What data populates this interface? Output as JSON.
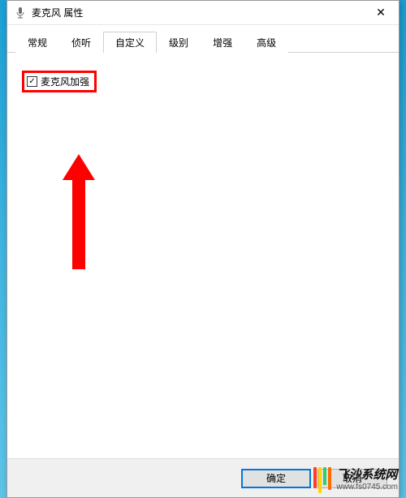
{
  "window": {
    "title": "麦克风 属性",
    "close_label": "✕"
  },
  "tabs": [
    {
      "label": "常规"
    },
    {
      "label": "侦听"
    },
    {
      "label": "自定义"
    },
    {
      "label": "级别"
    },
    {
      "label": "增强"
    },
    {
      "label": "高级"
    }
  ],
  "active_tab_index": 2,
  "custom_tab": {
    "mic_boost_label": "麦克风加强",
    "mic_boost_checked": true
  },
  "buttons": {
    "ok": "确定",
    "cancel": "取消"
  },
  "watermark": {
    "title": "飞沙系统网",
    "url": "www.fs0745.com"
  }
}
